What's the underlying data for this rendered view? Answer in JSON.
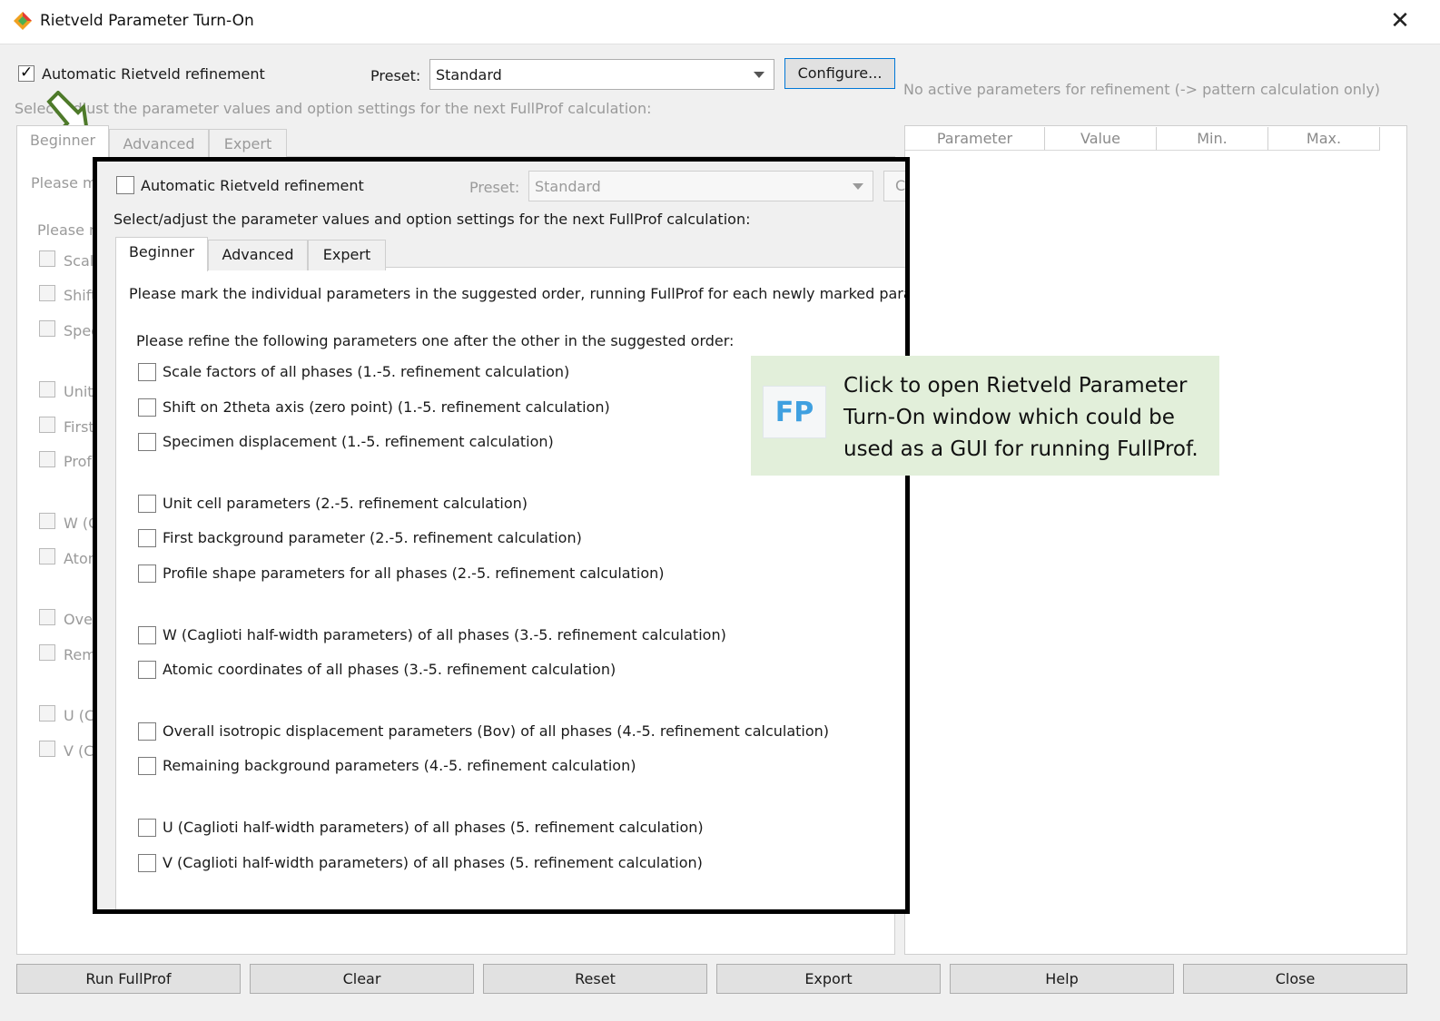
{
  "window": {
    "title": "Rietveld Parameter Turn-On",
    "close_glyph": "✕"
  },
  "top": {
    "auto_refinement_label": "Automatic Rietveld refinement",
    "auto_refinement_checked": true,
    "preset_label": "Preset:",
    "preset_value": "Standard",
    "configure_label": "Configure...",
    "instruction": "Select/adjust the parameter values and option settings for the next FullProf calculation:"
  },
  "tabs": [
    "Beginner",
    "Advanced",
    "Expert"
  ],
  "back_panel": {
    "intro_truncated": "Please ma",
    "order_truncated": "Please r",
    "truncated_items": [
      "Scal",
      "Shift",
      "Spec",
      "Unit",
      "First",
      "Prof",
      "W (C",
      "Aton",
      "Ove",
      "Rem",
      "U (C",
      "V (C"
    ]
  },
  "right_panel": {
    "status": "No active parameters for refinement (-> pattern calculation only)",
    "columns": [
      "Parameter",
      "Value",
      "Min.",
      "Max."
    ]
  },
  "inset": {
    "auto_refinement_label": "Automatic Rietveld refinement",
    "preset_label": "Preset:",
    "preset_value": "Standard",
    "configure_partial": "C",
    "instruction": "Select/adjust the parameter values and option settings for the next FullProf calculation:",
    "tabs": [
      "Beginner",
      "Advanced",
      "Expert"
    ],
    "intro": "Please mark the individual parameters in the suggested order, running FullProf for each newly marked parameter:",
    "order_heading": "Please refine the following parameters one after the other in the suggested order:",
    "items": [
      "Scale factors of all phases (1.-5. refinement calculation)",
      "Shift on 2theta axis (zero point) (1.-5. refinement calculation)",
      "Specimen displacement (1.-5. refinement calculation)",
      "Unit cell parameters (2.-5. refinement calculation)",
      "First background parameter (2.-5. refinement calculation)",
      "Profile shape parameters for all phases (2.-5. refinement calculation)",
      "W (Caglioti half-width parameters) of all phases (3.-5. refinement calculation)",
      "Atomic coordinates of all phases (3.-5. refinement calculation)",
      "Overall isotropic displacement parameters (Bov) of all phases (4.-5. refinement calculation)",
      "Remaining background parameters (4.-5. refinement calculation)",
      "U (Caglioti half-width parameters) of all phases (5. refinement calculation)",
      "V (Caglioti half-width parameters) of all phases (5. refinement calculation)"
    ]
  },
  "callout": {
    "icon_text": "FP",
    "text": "Click to open Rietveld Parameter Turn-On window which could be used as a GUI for running FullProf."
  },
  "buttons": [
    "Run FullProf",
    "Clear",
    "Reset",
    "Export",
    "Help",
    "Close"
  ],
  "colors": {
    "callout_bg": "#e2efda",
    "arrow": "#4e7a2a",
    "fp_blue": "#3fa0e0"
  }
}
